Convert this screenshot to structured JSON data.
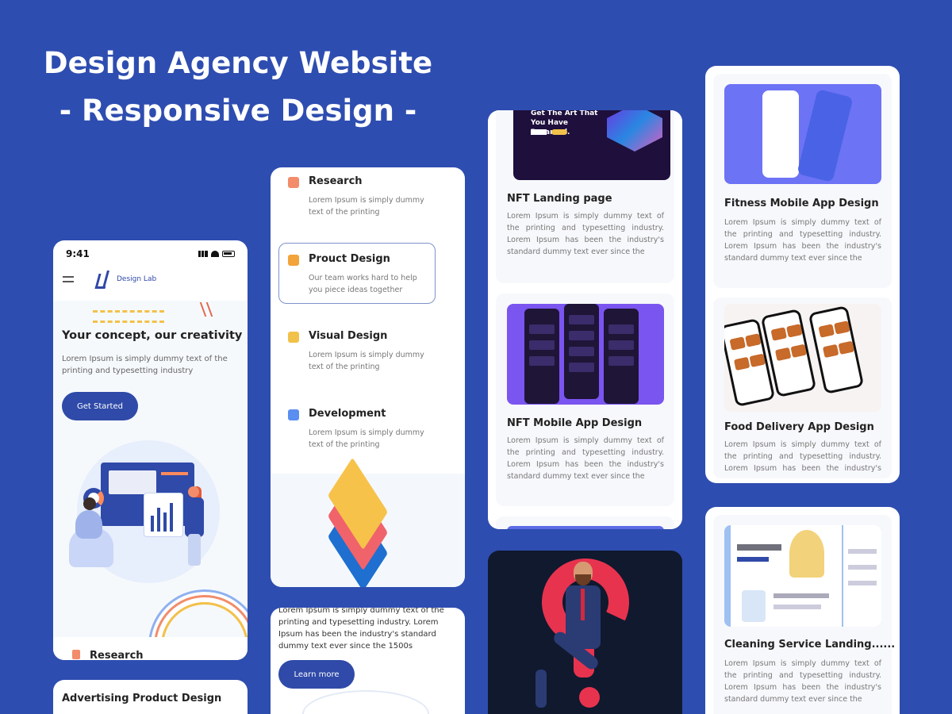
{
  "hero": {
    "title_line1": "Design Agency Website",
    "title_line2": "- Responsive Design -"
  },
  "phone": {
    "status_time": "9:41",
    "brand": "Design Lab",
    "headline": "Your concept, our creativity",
    "body": "Lorem Ipsum is simply dummy text of the printing and typesetting industry",
    "cta": "Get Started",
    "next_section": "Research"
  },
  "advertising": {
    "title": "Advertising Product Design"
  },
  "services": {
    "items": [
      {
        "title": "Research",
        "text": "Lorem Ipsum is simply dummy text of the printing"
      },
      {
        "title": "Prouct Design",
        "text": "Our team works hard to help you piece ideas together"
      },
      {
        "title": "Visual Design",
        "text": "Lorem Ipsum is simply dummy text of the printing"
      },
      {
        "title": "Development",
        "text": "Lorem Ipsum is simply dummy text of the printing"
      }
    ]
  },
  "services_bottom": {
    "text": "Lorem Ipsum is simply dummy text of the printing and typesetting industry. Lorem Ipsum has been the industry's standard dummy text ever since the 1500s",
    "cta": "Learn more"
  },
  "projects": {
    "nft_landing": {
      "hero_text": "Get The Art That You Have Dreamed.",
      "title": "NFT Landing page",
      "text": "Lorem Ipsum is simply dummy text of the printing and typesetting industry. Lorem Ipsum has been the industry's standard dummy text ever since the"
    },
    "nft_mobile": {
      "title": "NFT Mobile App Design",
      "text": "Lorem Ipsum is simply dummy text of the printing and typesetting industry. Lorem Ipsum has been the industry's standard dummy text ever since the"
    },
    "fitness": {
      "title": "Fitness Mobile App Design",
      "text": "Lorem Ipsum is simply dummy text of the printing and typesetting industry. Lorem Ipsum has been the industry's standard dummy text ever since the"
    },
    "food": {
      "title": "Food Delivery App Design",
      "text": "Lorem Ipsum is simply dummy text of the printing and typesetting industry. Lorem Ipsum has been the industry's standard dummy text ever since the"
    },
    "cleaning": {
      "title": "Cleaning Service Landing......",
      "text": "Lorem Ipsum is simply dummy text of the printing and typesetting industry. Lorem Ipsum has been the industry's standard dummy text ever since the"
    }
  },
  "colors": {
    "background": "#2e4db0",
    "accent": "#2f4aa8",
    "card": "#ffffff"
  }
}
